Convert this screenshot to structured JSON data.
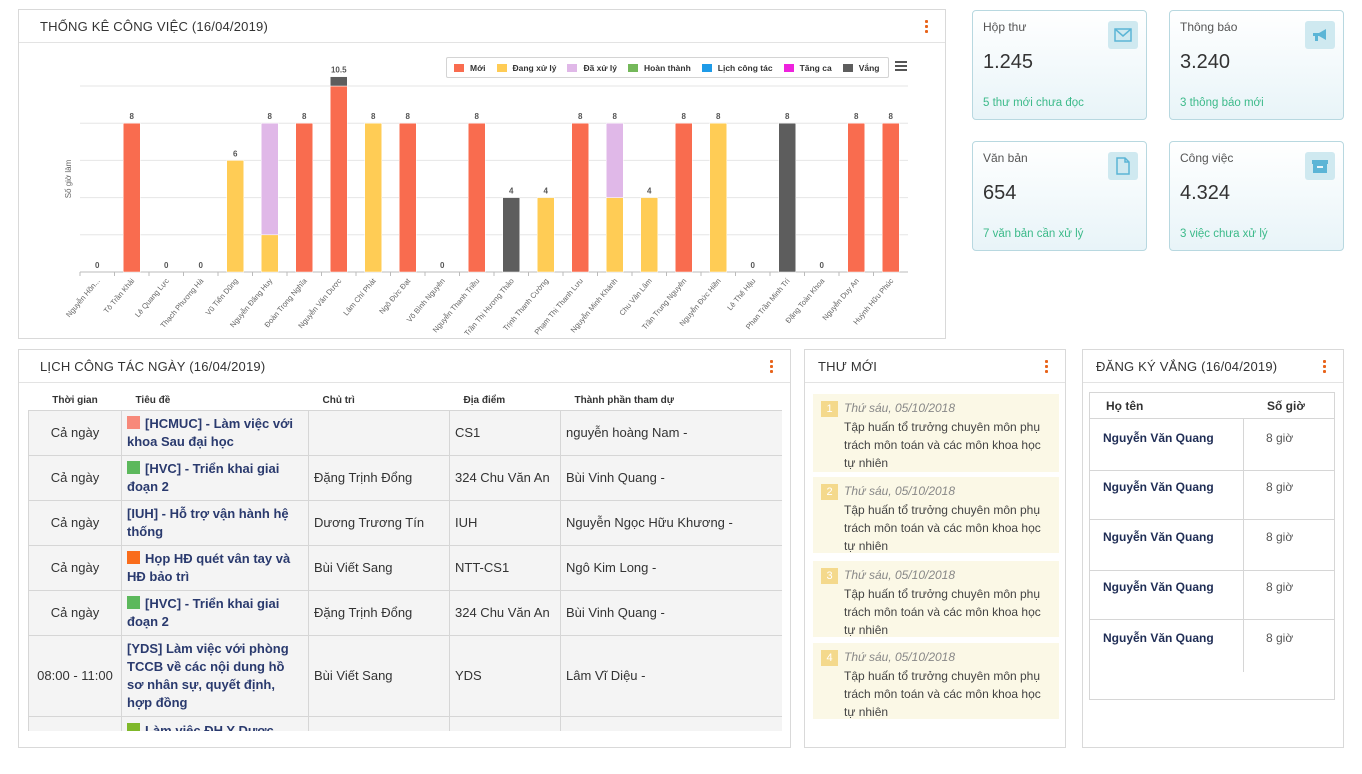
{
  "stats_panel": {
    "title": "THỐNG KÊ CÔNG VIỆC (16/04/2019)"
  },
  "stats": [
    {
      "label": "Hộp thư",
      "value": "1.245",
      "sub": "5 thư mới chưa đọc",
      "icon": "mail-icon"
    },
    {
      "label": "Thông báo",
      "value": "3.240",
      "sub": "3 thông báo mới",
      "icon": "megaphone-icon"
    },
    {
      "label": "Văn bản",
      "value": "654",
      "sub": "7 văn bản cần xử lý",
      "icon": "document-icon"
    },
    {
      "label": "Công việc",
      "value": "4.324",
      "sub": "3 việc chưa xử lý",
      "icon": "archive-icon"
    }
  ],
  "colors": {
    "accent": "#e8641b",
    "stat_sub": "#3cba8a"
  },
  "chart_data": {
    "type": "bar",
    "stacked": true,
    "ylabel": "Số giờ làm",
    "ylim": [
      0,
      11
    ],
    "grid": true,
    "legend_position": "top-right",
    "categories": [
      "Nguyễn Hồn...",
      "Tô Trần Khải",
      "Lê Quang Lực",
      "Thạch Phương Hà",
      "Vũ Tiến Dũng",
      "Nguyễn Đăng Huy",
      "Đoàn Trọng Nghĩa",
      "Nguyễn Văn Dược",
      "Lâm Chí Phát",
      "Ngô Đức Đạt",
      "Võ Bình Nguyên",
      "Nguyễn Thanh Triều",
      "Trần Thị Hương Thảo",
      "Trịnh Thanh Cường",
      "Phạm Thị Thanh Lưu",
      "Nguyễn Minh Khánh",
      "Chu Văn Lâm",
      "Trần Trung Nguyên",
      "Nguyễn Đức Hiền",
      "Lê Thế Hậu",
      "Phan Trần Minh Trí",
      "Đặng Toàn Khoa",
      "Nguyễn Duy An",
      "Huỳnh Hữu Phúc"
    ],
    "series": [
      {
        "name": "Mới",
        "color": "#f96c4f",
        "values": [
          0,
          8,
          0,
          0,
          0,
          0,
          8,
          10,
          0,
          8,
          0,
          8,
          0,
          0,
          8,
          0,
          0,
          8,
          0,
          0,
          0,
          0,
          8,
          8
        ]
      },
      {
        "name": "Đang xử lý",
        "color": "#ffcc55",
        "values": [
          0,
          0,
          0,
          0,
          6,
          2,
          0,
          0,
          8,
          0,
          0,
          0,
          0,
          4,
          0,
          4,
          4,
          0,
          8,
          0,
          0,
          0,
          0,
          0
        ]
      },
      {
        "name": "Đã xử lý",
        "color": "#e0b8e8",
        "values": [
          0,
          0,
          0,
          0,
          0,
          6,
          0,
          0,
          0,
          0,
          0,
          0,
          0,
          0,
          0,
          4,
          0,
          0,
          0,
          0,
          0,
          0,
          0,
          0
        ]
      },
      {
        "name": "Hoàn thành",
        "color": "#74b85a",
        "values": [
          0,
          0,
          0,
          0,
          0,
          0,
          0,
          0,
          0,
          0,
          0,
          0,
          0,
          0,
          0,
          0,
          0,
          0,
          0,
          0,
          0,
          0,
          0,
          0
        ]
      },
      {
        "name": "Lịch công tác",
        "color": "#1e9be8",
        "values": [
          0,
          0,
          0,
          0,
          0,
          0,
          0,
          0,
          0,
          0,
          0,
          0,
          0,
          0,
          0,
          0,
          0,
          0,
          0,
          0,
          0,
          0,
          0,
          0
        ]
      },
      {
        "name": "Tăng ca",
        "color": "#ee22dd",
        "values": [
          0,
          0,
          0,
          0,
          0,
          0,
          0,
          0,
          0,
          0,
          0,
          0,
          0,
          0,
          0,
          0,
          0,
          0,
          0,
          0,
          0,
          0,
          0,
          0
        ]
      },
      {
        "name": "Vắng",
        "color": "#5d5d5d",
        "values": [
          0,
          0,
          0,
          0,
          0,
          0,
          0,
          0.5,
          0,
          0,
          0,
          0,
          4,
          0,
          0,
          0,
          0,
          0,
          0,
          0,
          8,
          0,
          0,
          0
        ]
      }
    ],
    "totals": [
      "0",
      "8",
      "0",
      "0",
      "6",
      "8",
      "8",
      "10.5",
      "8",
      "8",
      "0",
      "8",
      "4",
      "4",
      "8",
      "8",
      "4",
      "8",
      "8",
      "0",
      "8",
      "0",
      "8",
      "8"
    ]
  },
  "schedule": {
    "title": "LỊCH CÔNG TÁC NGÀY (16/04/2019)",
    "columns": [
      "Thời gian",
      "Tiêu đề",
      "Chủ trì",
      "Địa điểm",
      "Thành phần tham dự"
    ],
    "rows": [
      {
        "time": "Cả ngày",
        "title": "[HCMUC] - Làm việc với khoa Sau đại học",
        "color": "#f7897a",
        "host": "",
        "place": "CS1",
        "attendees": "nguyễn hoàng Nam -"
      },
      {
        "time": "Cả ngày",
        "title": "[HVC] - Triển khai giai đoạn 2",
        "color": "#5cb85c",
        "host": "Đặng Trịnh Đổng",
        "place": "324 Chu Văn An",
        "attendees": "Bùi Vinh Quang -"
      },
      {
        "time": "Cả ngày",
        "title": "[IUH] - Hỗ trợ vận hành hệ thống",
        "color": "",
        "host": "Dương Trương Tín",
        "place": "IUH",
        "attendees": "Nguyễn Ngọc Hữu Khương -"
      },
      {
        "time": "Cả ngày",
        "title": "Họp HĐ quét vân tay và HĐ bảo trì",
        "color": "#f96c1b",
        "host": "Bùi Viết Sang",
        "place": "NTT-CS1",
        "attendees": "Ngô Kim Long -"
      },
      {
        "time": "Cả ngày",
        "title": "[HVC] - Triển khai giai đoạn 2",
        "color": "#5cb85c",
        "host": "Đặng Trịnh Đổng",
        "place": "324 Chu Văn An",
        "attendees": "Bùi Vinh Quang -"
      },
      {
        "time": "08:00 - 11:00",
        "title": "[YDS] Làm việc với phòng TCCB về các nội dung hồ sơ nhân sự, quyết định, hợp đồng",
        "color": "",
        "host": "Bùi Viết Sang",
        "place": "YDS",
        "attendees": "Lâm Vĩ Diệu -"
      },
      {
        "time": "",
        "title": "Làm việc ĐH Y Dược",
        "color": "#7fb82a",
        "host": "",
        "place": "",
        "attendees": ""
      }
    ]
  },
  "mail": {
    "title": "THƯ MỚI",
    "items": [
      {
        "num": "1",
        "date": "Thứ sáu, 05/10/2018",
        "text": "Tập huấn tổ trưởng chuyên môn phụ trách môn toán và các môn khoa học tự nhiên"
      },
      {
        "num": "2",
        "date": "Thứ sáu, 05/10/2018",
        "text": "Tập huấn tổ trưởng chuyên môn phụ trách môn toán và các môn khoa học tự nhiên"
      },
      {
        "num": "3",
        "date": "Thứ sáu, 05/10/2018",
        "text": "Tập huấn tổ trưởng chuyên môn phụ trách môn toán và các môn khoa học tự nhiên"
      },
      {
        "num": "4",
        "date": "Thứ sáu, 05/10/2018",
        "text": "Tập huấn tổ trưởng chuyên môn phụ trách môn toán và các môn khoa học tự nhiên"
      }
    ]
  },
  "absence": {
    "title": "ĐĂNG KÝ VẮNG (16/04/2019)",
    "col_name": "Họ tên",
    "col_hours": "Số giờ",
    "rows": [
      {
        "name": "Nguyễn Văn Quang",
        "hours": "8 giờ"
      },
      {
        "name": "Nguyễn Văn Quang",
        "hours": "8 giờ"
      },
      {
        "name": "Nguyễn Văn Quang",
        "hours": "8 giờ"
      },
      {
        "name": "Nguyễn Văn Quang",
        "hours": "8 giờ"
      },
      {
        "name": "Nguyễn Văn Quang",
        "hours": "8 giờ"
      }
    ]
  }
}
